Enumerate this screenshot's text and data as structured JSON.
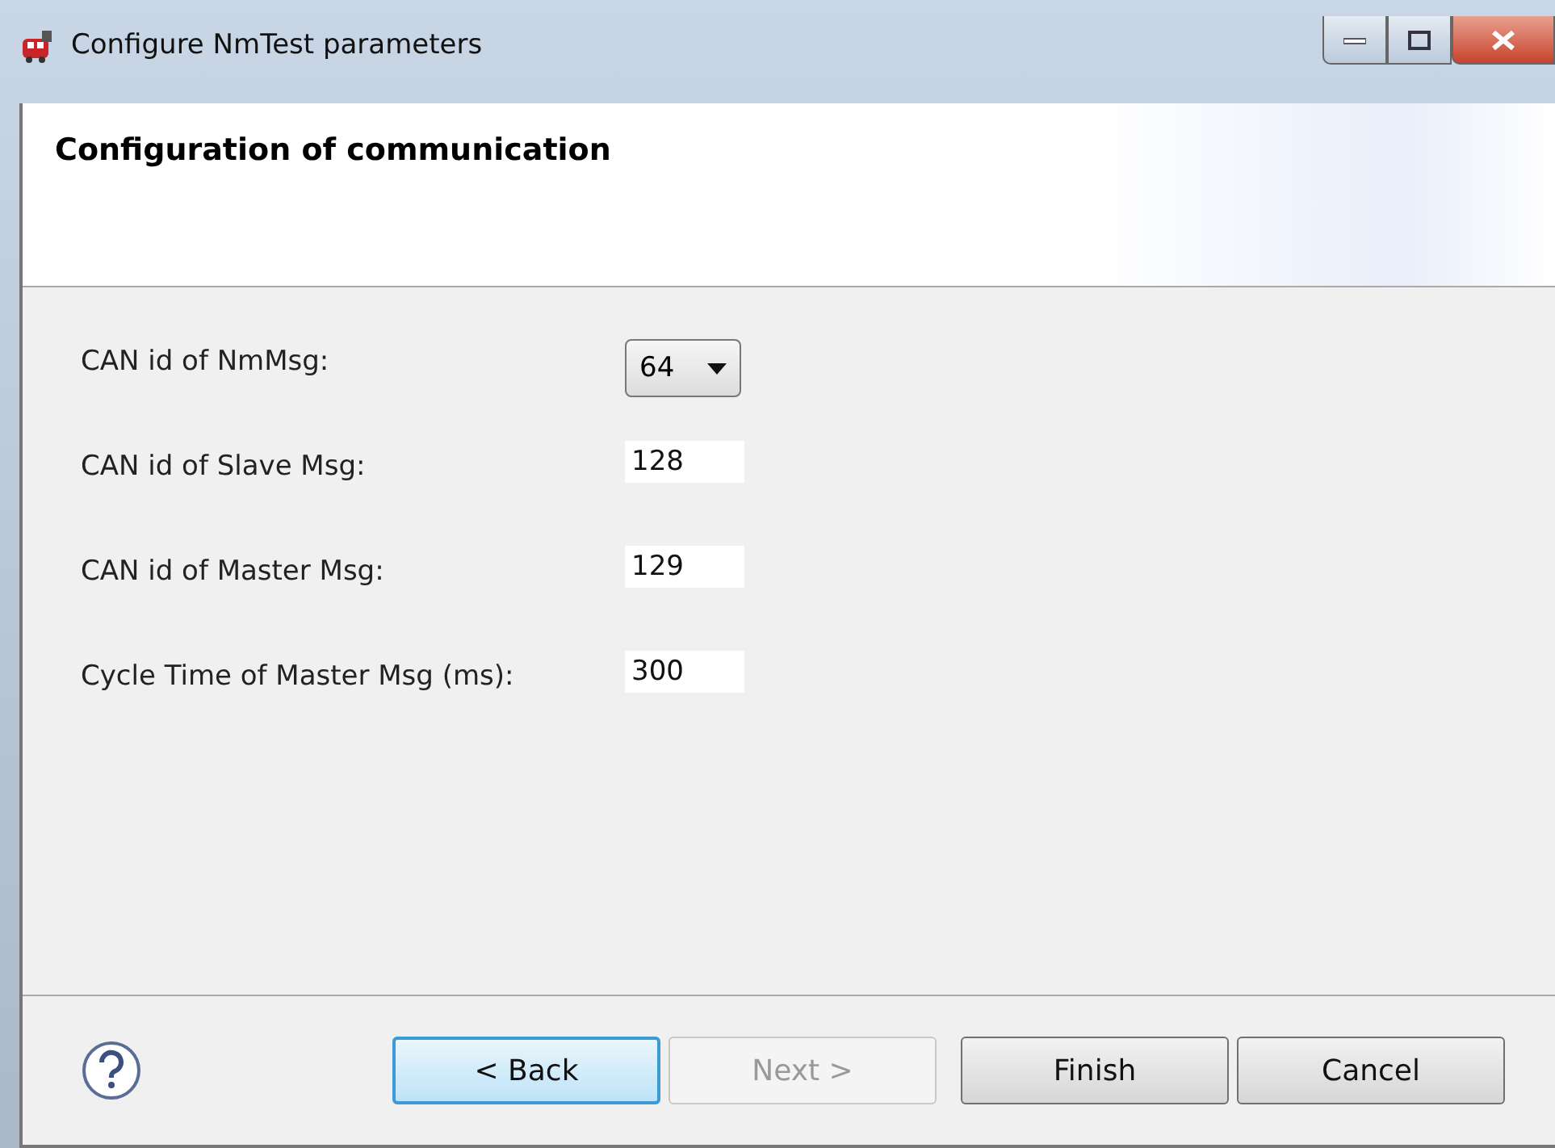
{
  "window": {
    "title": "Configure NmTest parameters"
  },
  "header": {
    "title": "Configuration of communication"
  },
  "fields": [
    {
      "label": "CAN id of NmMsg:",
      "kind": "dropdown",
      "value": "64"
    },
    {
      "label": "CAN id of Slave Msg:",
      "kind": "text",
      "value": "128"
    },
    {
      "label": "CAN id of Master Msg:",
      "kind": "text",
      "value": "129"
    },
    {
      "label": "Cycle Time of Master Msg (ms):",
      "kind": "text",
      "value": "300"
    }
  ],
  "buttons": [
    {
      "label": "< Back",
      "disabled": false,
      "focused": true
    },
    {
      "label": "Next >",
      "disabled": true,
      "focused": false
    },
    {
      "label": "Finish",
      "disabled": false,
      "focused": false
    },
    {
      "label": "Cancel",
      "disabled": false,
      "focused": false
    }
  ]
}
